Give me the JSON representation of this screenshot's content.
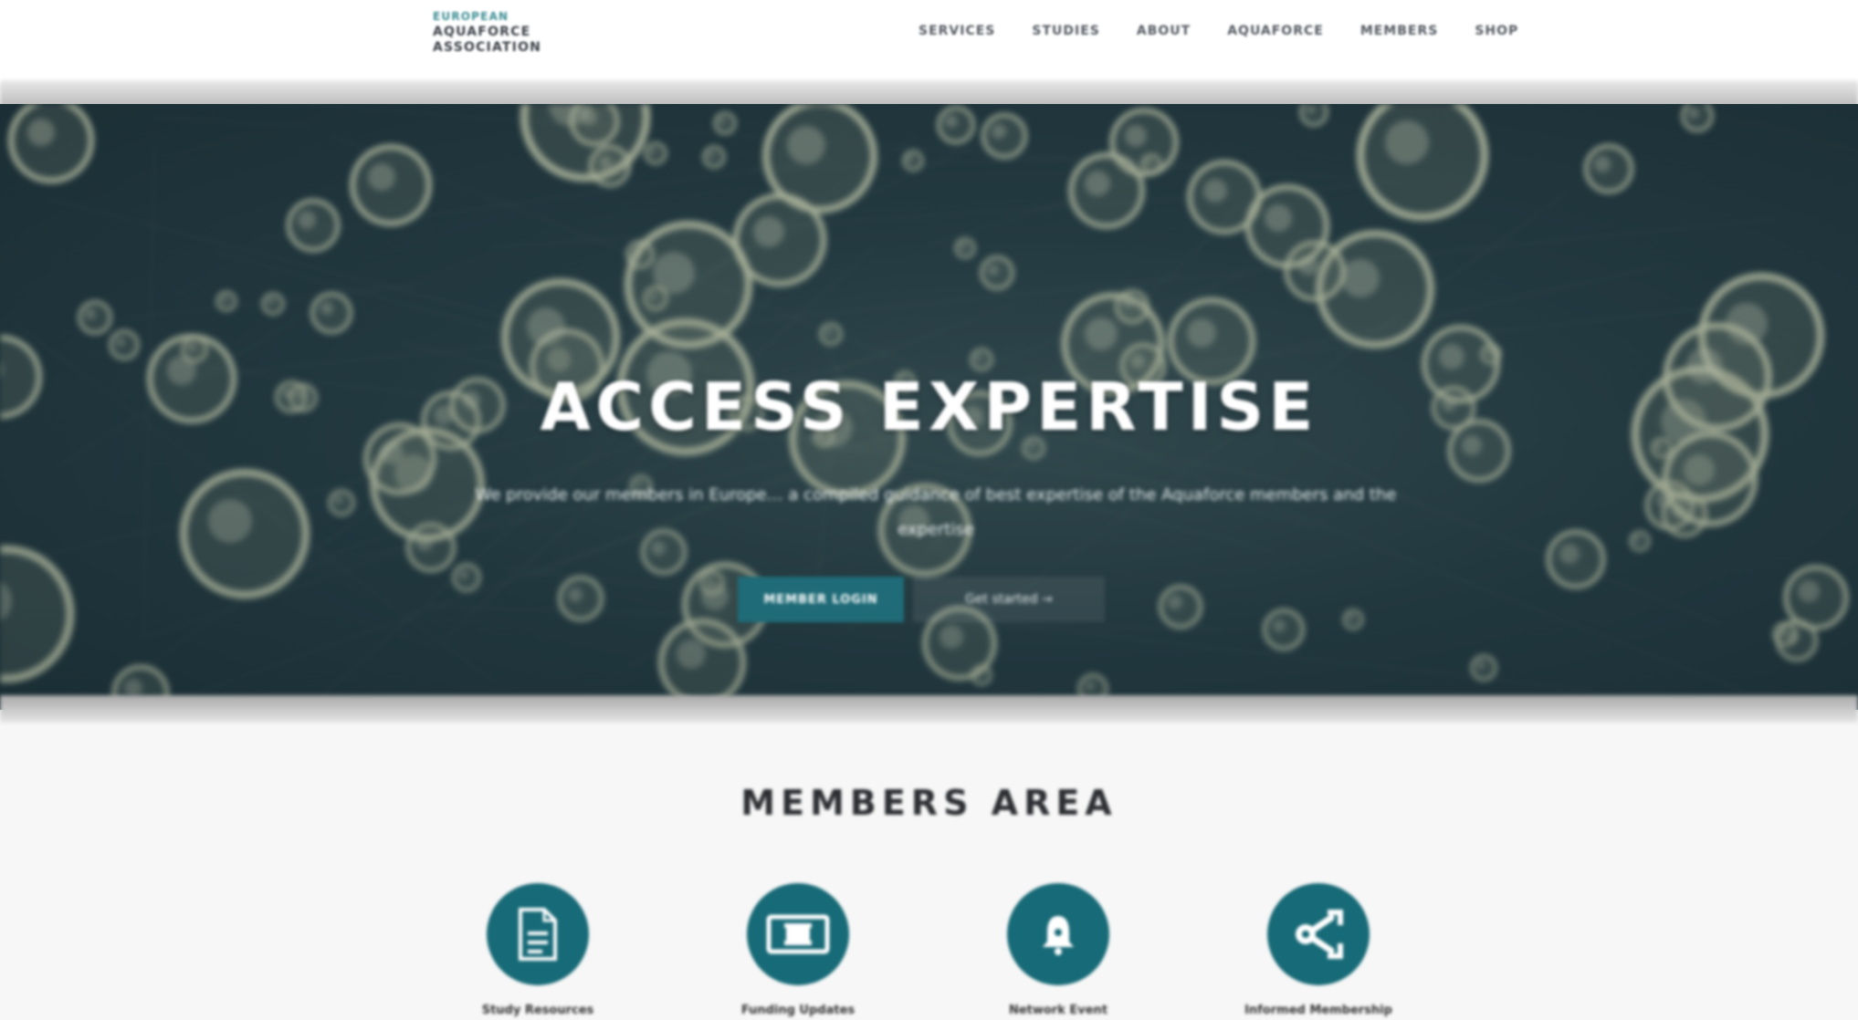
{
  "header": {
    "logo": {
      "line1": "EUROPEAN",
      "line2": "AQUAFORCE",
      "line3": "ASSOCIATION"
    },
    "nav": [
      {
        "label": "SERVICES"
      },
      {
        "label": "STUDIES"
      },
      {
        "label": "ABOUT"
      },
      {
        "label": "AQUAFORCE"
      },
      {
        "label": "MEMBERS"
      },
      {
        "label": "SHOP"
      }
    ]
  },
  "hero": {
    "title": "ACCESS EXPERTISE",
    "subtitle": "We provide our members in Europe… a compiled guidance of best expertise of the Aquaforce members and the expertise",
    "primary_button": "MEMBER LOGIN",
    "secondary_button": "Get started →"
  },
  "members": {
    "title": "MEMBERS AREA",
    "features": [
      {
        "icon": "document-icon",
        "label": "Study Resources"
      },
      {
        "icon": "ticket-icon",
        "label": "Funding Updates"
      },
      {
        "icon": "bell-icon",
        "label": "Network Event"
      },
      {
        "icon": "network-icon",
        "label": "Informed Membership"
      }
    ]
  },
  "colors": {
    "accent": "#176a77",
    "logo_accent": "#3d8d93",
    "hero_dark": "#283f46"
  }
}
